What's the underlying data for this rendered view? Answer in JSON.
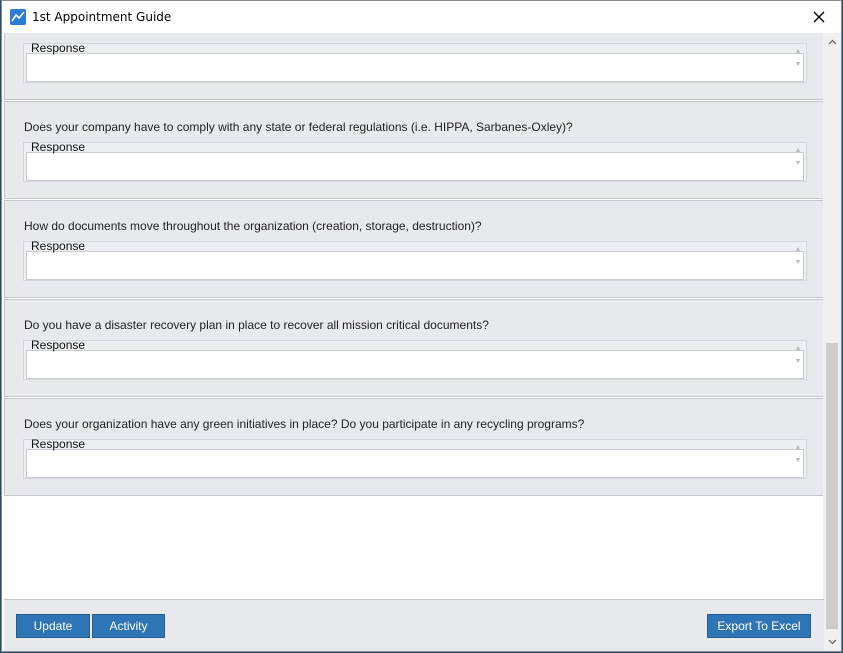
{
  "window": {
    "title": "1st Appointment Guide"
  },
  "questions": [
    {
      "text": "",
      "response_label": "Response",
      "response_value": ""
    },
    {
      "text": "Does your company have to comply with any state or federal regulations (i.e. HIPPA, Sarbanes-Oxley)?",
      "response_label": "Response",
      "response_value": ""
    },
    {
      "text": "How do documents move throughout the organization (creation, storage, destruction)?",
      "response_label": "Response",
      "response_value": ""
    },
    {
      "text": "Do you have a disaster recovery plan in place to recover all mission critical documents?",
      "response_label": "Response",
      "response_value": ""
    },
    {
      "text": "Does your organization have any green initiatives in place?  Do you participate in any recycling programs?",
      "response_label": "Response",
      "response_value": ""
    }
  ],
  "footer": {
    "update_label": "Update",
    "activity_label": "Activity",
    "export_label": "Export To Excel"
  },
  "colors": {
    "button": "#2e75b6",
    "panel": "#e8e9ed"
  }
}
